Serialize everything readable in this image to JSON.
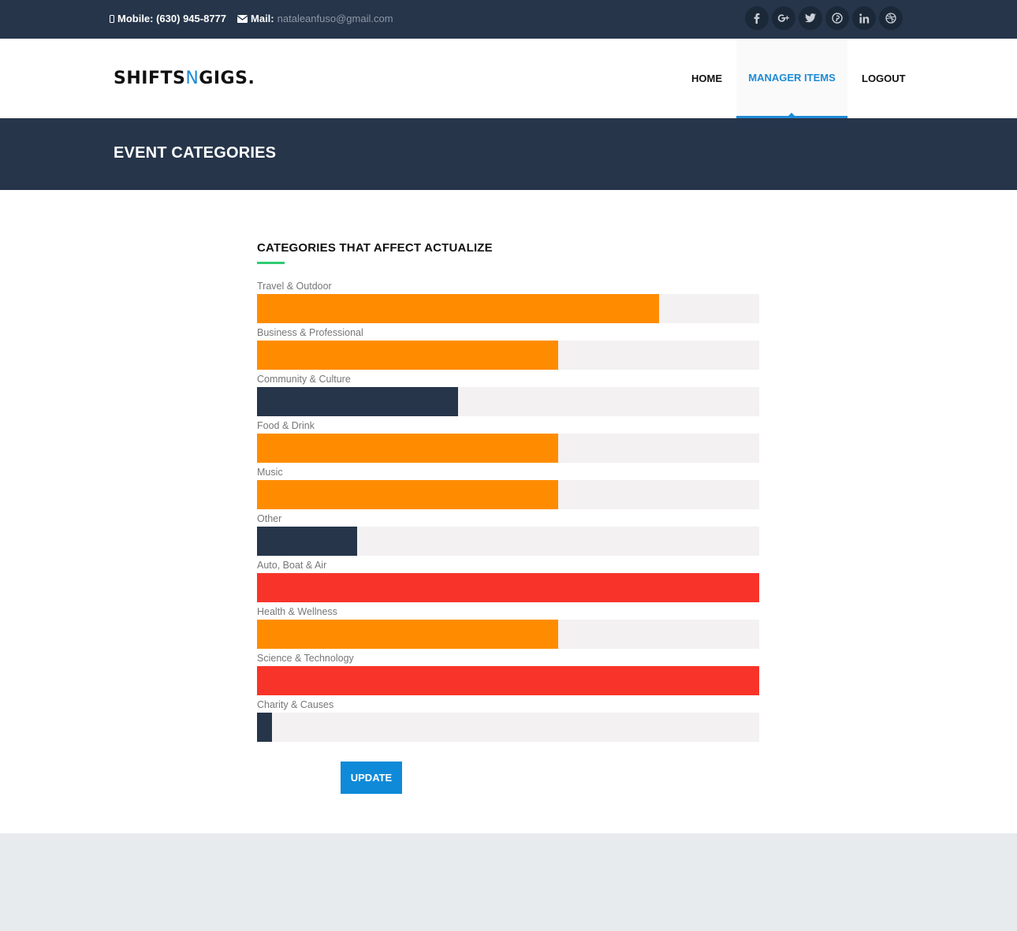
{
  "topbar": {
    "mobile_label": "Mobile: (630) 945-8777",
    "mail_label": "Mail:",
    "mail_value": "nataleanfuso@gmail.com",
    "socials": [
      {
        "name": "facebook-icon",
        "glyph": "f"
      },
      {
        "name": "google-plus-icon",
        "glyph": "g+"
      },
      {
        "name": "twitter-icon",
        "glyph": "t"
      },
      {
        "name": "pinterest-icon",
        "glyph": "p"
      },
      {
        "name": "linkedin-icon",
        "glyph": "in"
      },
      {
        "name": "dribbble-icon",
        "glyph": "d"
      }
    ]
  },
  "header": {
    "logo_part1": "SHIFTS",
    "logo_part2": "N",
    "logo_part3": "GIGS.",
    "nav": {
      "home": "HOME",
      "manager": "MANAGER ITEMS",
      "logout": "LOGOUT"
    }
  },
  "page": {
    "title": "EVENT CATEGORIES"
  },
  "section": {
    "title": "CATEGORIES THAT AFFECT ACTUALIZE"
  },
  "colors": {
    "orange": "#ff8c00",
    "navy": "#26354a",
    "red": "#f8342a",
    "accent": "#1e8ad6",
    "track": "#f3f1f1"
  },
  "categories": [
    {
      "label": "Travel & Outdoor",
      "level": 0.8,
      "color": "#ff8c00"
    },
    {
      "label": "Business & Professional",
      "level": 0.6,
      "color": "#ff8c00"
    },
    {
      "label": "Community & Culture",
      "level": 0.4,
      "color": "#26354a"
    },
    {
      "label": "Food & Drink",
      "level": 0.6,
      "color": "#ff8c00"
    },
    {
      "label": "Music",
      "level": 0.6,
      "color": "#ff8c00"
    },
    {
      "label": "Other",
      "level": 0.2,
      "color": "#26354a"
    },
    {
      "label": "Auto, Boat & Air",
      "level": 1.0,
      "color": "#f8342a"
    },
    {
      "label": "Health & Wellness",
      "level": 0.6,
      "color": "#ff8c00"
    },
    {
      "label": "Science & Technology",
      "level": 1.0,
      "color": "#f8342a"
    },
    {
      "label": "Charity & Causes",
      "level": 0.03,
      "color": "#26354a"
    }
  ],
  "actions": {
    "update_label": "UPDATE"
  }
}
